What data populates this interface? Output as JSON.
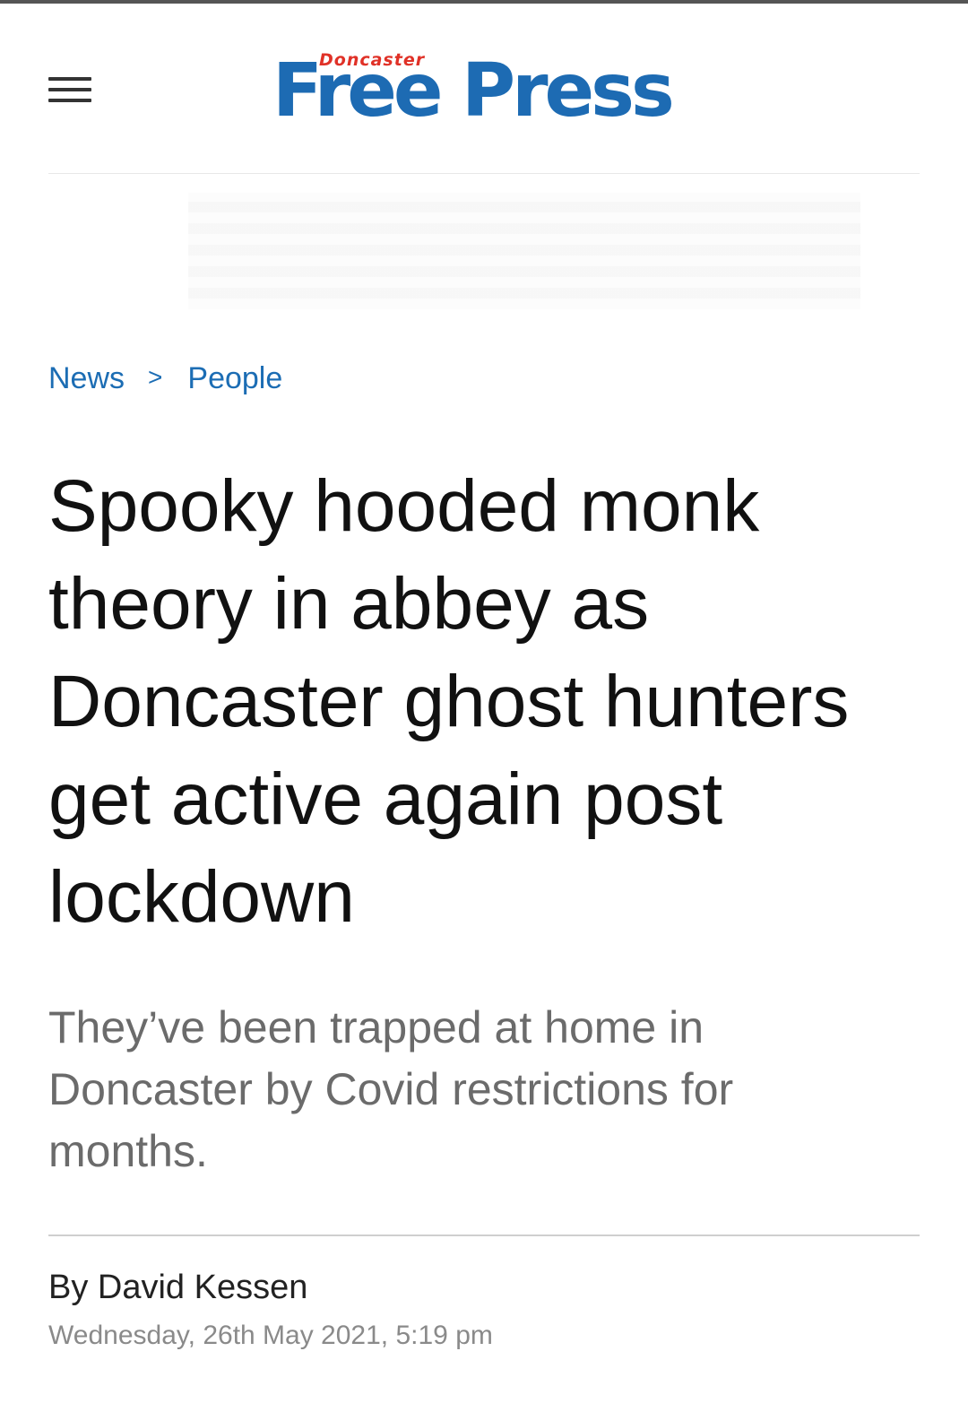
{
  "header": {
    "menu_icon": "hamburger-menu-icon",
    "logo_small": "Doncaster",
    "logo_big": "Free Press",
    "logo_colors": {
      "blue": "#1d6bb3",
      "red": "#e03127"
    }
  },
  "breadcrumb": {
    "items": [
      "News",
      "People"
    ],
    "separator": ">"
  },
  "article": {
    "headline": "Spooky hooded monk theory in abbey as Doncaster ghost hunters get active again post lockdown",
    "standfirst": "They’ve been trapped at home in Doncaster by Covid restrictions for months.",
    "author": "By David Kessen",
    "date": "Wednesday, 26th May 2021, 5:19 pm"
  },
  "colors": {
    "link": "#1c6db4",
    "headline": "#111111",
    "standfirst": "#6b6b6b",
    "date": "#8a8a8a"
  }
}
